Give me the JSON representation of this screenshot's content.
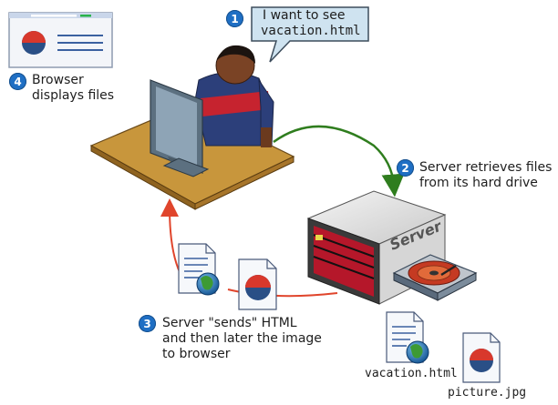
{
  "steps": [
    {
      "number": "1",
      "lines": [
        "I want to see",
        "vacation.html"
      ]
    },
    {
      "number": "2",
      "lines": [
        "Server retrieves files",
        "from its hard drive"
      ]
    },
    {
      "number": "3",
      "lines": [
        "Server \"sends\" HTML",
        "and then later the image",
        "to browser"
      ]
    },
    {
      "number": "4",
      "lines": [
        "Browser",
        "displays files"
      ]
    }
  ],
  "server_label": "Server",
  "files": {
    "html_file": "vacation.html",
    "image_file": "picture.jpg"
  },
  "colors": {
    "badge": "#1f6fc4",
    "request_arrow": "#2f7d1e",
    "response_arrow": "#e0452c",
    "desk": "#c8963c",
    "server_front": "#b5172a",
    "doc_pie": "#d8382c",
    "doc_pie_blue": "#2a4f86"
  },
  "icons": [
    "person-icon",
    "monitor-icon",
    "server-icon",
    "hard-drive-icon",
    "document-icon",
    "globe-icon",
    "pie-chart-icon",
    "browser-window-icon"
  ]
}
